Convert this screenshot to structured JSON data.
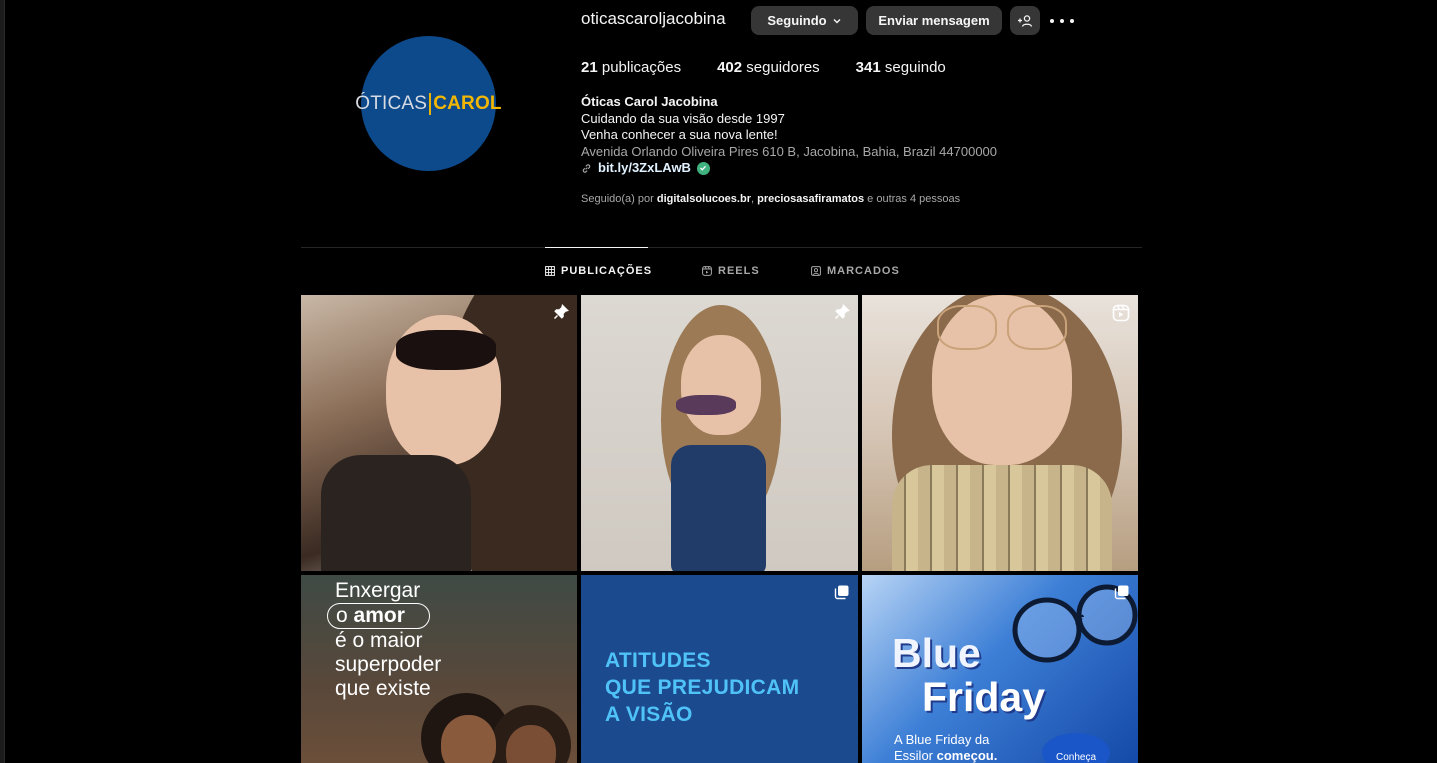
{
  "profile": {
    "username": "oticascaroljacobina",
    "avatar_logo_part1": "ÓTICAS",
    "avatar_logo_part2": "CAROL",
    "following_button": "Seguindo",
    "message_button": "Enviar mensagem",
    "stats": {
      "posts_count": "21",
      "posts_label": "publicações",
      "followers_count": "402",
      "followers_label": "seguidores",
      "following_count": "341",
      "following_label": "seguindo"
    },
    "bio": {
      "name": "Óticas Carol Jacobina",
      "line1": "Cuidando da sua visão desde 1997",
      "line2": "Venha conhecer a sua nova lente!",
      "address": "Avenida Orlando Oliveira Pires 610 B, Jacobina, Bahia, Brazil 44700000",
      "link": "bit.ly/3ZxLAwB"
    },
    "followed_by": {
      "prefix": "Seguido(a) por",
      "user1": "digitalsolucoes.br",
      "sep": ",",
      "user2": "preciosasafiramatos",
      "suffix": "e outras 4 pessoas"
    }
  },
  "tabs": {
    "posts": "PUBLICAÇÕES",
    "reels": "REELS",
    "tagged": "MARCADOS"
  },
  "posts": {
    "tile4": {
      "line1": "Enxergar",
      "line2a": "o ",
      "line2b": "amor",
      "line3": "é o maior",
      "line4": "superpoder",
      "line5": "que existe"
    },
    "tile5": {
      "line1": "ATITUDES",
      "line2": "QUE PREJUDICAM",
      "line3": "A VISÃO"
    },
    "tile6": {
      "title1": "Blue",
      "title2": "Friday",
      "sub1": "A Blue Friday da",
      "sub2a": "Essilor ",
      "sub2b": "começou.",
      "badge": "Conheça"
    }
  },
  "colors": {
    "background": "#000000",
    "button_bg": "#363636",
    "avatar_bg": "#0d4a8c",
    "verified": "#3fb27f"
  }
}
